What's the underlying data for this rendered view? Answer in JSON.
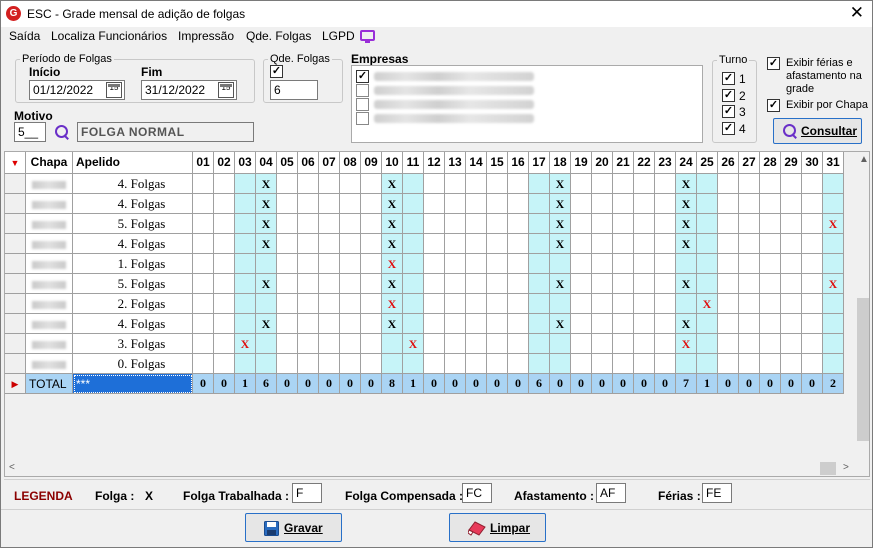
{
  "window": {
    "title": "ESC - Grade mensal de adição de folgas",
    "close_glyph": "✕",
    "app_icon": "G"
  },
  "menu": [
    "Saída",
    "Localiza Funcionários",
    "Impressão",
    "Qde. Folgas",
    "LGPD"
  ],
  "periodo": {
    "legend": "Período de Folgas",
    "inicio_label": "Início",
    "inicio": "01/12/2022",
    "fim_label": "Fim",
    "fim": "31/12/2022",
    "cal_glyph": "15"
  },
  "qde": {
    "legend": "Qde. Folgas",
    "checked": true,
    "value": "6"
  },
  "motivo": {
    "label": "Motivo",
    "code": "5__",
    "description": "FOLGA NORMAL"
  },
  "empresas": {
    "label": "Empresas",
    "rows": [
      {
        "checked": true
      },
      {
        "checked": false
      },
      {
        "checked": false
      },
      {
        "checked": false
      }
    ]
  },
  "turno": {
    "legend": "Turno",
    "items": [
      {
        "label": "1",
        "checked": true
      },
      {
        "label": "2",
        "checked": true
      },
      {
        "label": "3",
        "checked": true
      },
      {
        "label": "4",
        "checked": true
      }
    ]
  },
  "options": {
    "exibir_ferias": "Exibir férias e afastamento na grade",
    "exibir_ferias_checked": true,
    "exibir_chapa": "Exibir por Chapa",
    "exibir_chapa_checked": true
  },
  "consultar_label": "Consultar",
  "grid": {
    "head_chapa": "Chapa",
    "head_apelido": "Apelido",
    "days": [
      "01",
      "02",
      "03",
      "04",
      "05",
      "06",
      "07",
      "08",
      "09",
      "10",
      "11",
      "12",
      "13",
      "14",
      "15",
      "16",
      "17",
      "18",
      "19",
      "20",
      "21",
      "22",
      "23",
      "24",
      "25",
      "26",
      "27",
      "28",
      "29",
      "30",
      "31"
    ],
    "highlight_days": [
      3,
      4,
      10,
      11,
      17,
      18,
      24,
      25,
      31
    ],
    "rows": [
      {
        "apelido": "4. Folgas",
        "marks": {
          "4": "F",
          "10": "F",
          "18": "F",
          "24": "F"
        }
      },
      {
        "apelido": "4. Folgas",
        "marks": {
          "4": "F",
          "10": "F",
          "18": "F",
          "24": "F"
        }
      },
      {
        "apelido": "5. Folgas",
        "marks": {
          "4": "F",
          "10": "F",
          "18": "F",
          "24": "F",
          "31": "N"
        }
      },
      {
        "apelido": "4. Folgas",
        "marks": {
          "4": "F",
          "10": "F",
          "18": "F",
          "24": "F"
        }
      },
      {
        "apelido": "1. Folgas",
        "marks": {
          "10": "N"
        }
      },
      {
        "apelido": "5. Folgas",
        "marks": {
          "4": "F",
          "10": "F",
          "18": "F",
          "24": "F",
          "31": "N"
        }
      },
      {
        "apelido": "2. Folgas",
        "marks": {
          "10": "N",
          "25": "N"
        }
      },
      {
        "apelido": "4. Folgas",
        "marks": {
          "4": "F",
          "10": "F",
          "18": "F",
          "24": "F"
        }
      },
      {
        "apelido": "3. Folgas",
        "marks": {
          "3": "N",
          "11": "N",
          "24": "N"
        }
      },
      {
        "apelido": "0. Folgas",
        "marks": {}
      }
    ],
    "mark_glyph": "X",
    "mark_colors": {
      "F": "#000000",
      "N": "#e01010"
    },
    "total_label": "TOTAL",
    "total_apelido": "***",
    "totals": [
      "0",
      "0",
      "1",
      "6",
      "0",
      "0",
      "0",
      "0",
      "0",
      "8",
      "1",
      "0",
      "0",
      "0",
      "0",
      "0",
      "6",
      "0",
      "0",
      "0",
      "0",
      "0",
      "0",
      "7",
      "1",
      "0",
      "0",
      "0",
      "0",
      "0",
      "2"
    ]
  },
  "legend": {
    "title": "LEGENDA",
    "folga_label": "Folga :",
    "folga_value": "X",
    "trabalhada_label": "Folga Trabalhada :",
    "trabalhada_value": "F",
    "compensada_label": "Folga Compensada :",
    "compensada_value": "FC",
    "afastamento_label": "Afastamento :",
    "afastamento_value": "AF",
    "ferias_label": "Férias :",
    "ferias_value": "FE"
  },
  "buttons": {
    "gravar": "Gravar",
    "limpar": "Limpar"
  },
  "colors": {
    "highlight": "#c6f4f8",
    "total_row": "#aad4f4",
    "mark_normal": "#e01010",
    "accent": "#6a2fc8",
    "legend_red": "#8b0000"
  }
}
